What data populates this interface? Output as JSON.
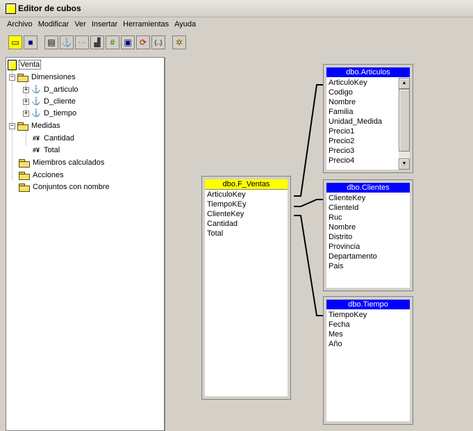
{
  "window": {
    "title": "Editor de cubos"
  },
  "menu": [
    "Archivo",
    "Modificar",
    "Ver",
    "Insertar",
    "Herramientas",
    "Ayuda"
  ],
  "toolbar": [
    {
      "icon": "new-cube-icon",
      "glyph": "▭"
    },
    {
      "icon": "save-icon",
      "glyph": "■"
    },
    {
      "icon": "properties-icon",
      "glyph": "▤"
    },
    {
      "icon": "dimension-icon",
      "glyph": "⚓"
    },
    {
      "icon": "grid-icon",
      "glyph": "⋯"
    },
    {
      "icon": "calculated-member-icon",
      "glyph": "▟"
    },
    {
      "icon": "measure-icon",
      "glyph": "#"
    },
    {
      "icon": "data-view-icon",
      "glyph": "▣"
    },
    {
      "icon": "process-icon",
      "glyph": "⟳"
    },
    {
      "icon": "script-icon",
      "glyph": "{..}"
    },
    {
      "icon": "wizard-icon",
      "glyph": "✲"
    }
  ],
  "tree": {
    "root": "Venta",
    "dimensions_label": "Dimensiones",
    "dimensions": [
      "D_articulo",
      "D_cliente",
      "D_tiempo"
    ],
    "measures_label": "Medidas",
    "measures": [
      "Cantidad",
      "Total"
    ],
    "calculated_members": "Miembros calculados",
    "actions": "Acciones",
    "named_sets": "Conjuntos con nombre"
  },
  "tables": {
    "fact": {
      "name": "dbo.F_Ventas",
      "fields": [
        "ArticuloKey",
        "TiempoKEy",
        "ClienteKey",
        "Cantidad",
        "Total"
      ]
    },
    "articulos": {
      "name": "dbo.Articulos",
      "fields": [
        "ArticuloKey",
        "Codigo",
        "Nombre",
        "Familia",
        "Unidad_Medida",
        "Precio1",
        "Precio2",
        "Precio3",
        "Precio4"
      ]
    },
    "clientes": {
      "name": "dbo.Clientes",
      "fields": [
        "ClienteKey",
        "ClienteId",
        "Ruc",
        "Nombre",
        "Distrito",
        "Provincia",
        "Departamento",
        "Pais"
      ]
    },
    "tiempo": {
      "name": "dbo.Tiempo",
      "fields": [
        "TiempoKey",
        "Fecha",
        "Mes",
        "Año"
      ]
    }
  },
  "colors": {
    "fact_header": "#ffff00",
    "dim_header": "#0000ff",
    "chrome": "#d4d0c8"
  }
}
